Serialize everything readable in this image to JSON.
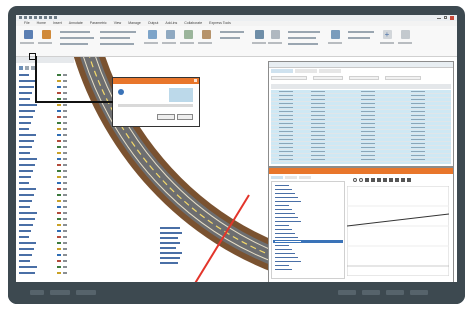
{
  "app": {
    "title": "",
    "menu": [
      "File",
      "Home",
      "Insert",
      "Annotate",
      "Parametric",
      "View",
      "Manage",
      "Output",
      "Add-ins",
      "Collaborate",
      "Express Tools"
    ],
    "accent": "#e8762b",
    "road_color": "#7a5230",
    "line_color": "#e3352b"
  },
  "dialog": {
    "title": "",
    "message": "",
    "ok_label": "",
    "cancel_label": ""
  },
  "table_window": {
    "title": "",
    "tabs": [
      "",
      "",
      ""
    ],
    "columns": [
      "",
      "",
      "",
      "",
      ""
    ]
  },
  "profile_window": {
    "title": "",
    "tabs": [
      "",
      "",
      ""
    ]
  },
  "labels": {
    "canvas_label": ""
  }
}
